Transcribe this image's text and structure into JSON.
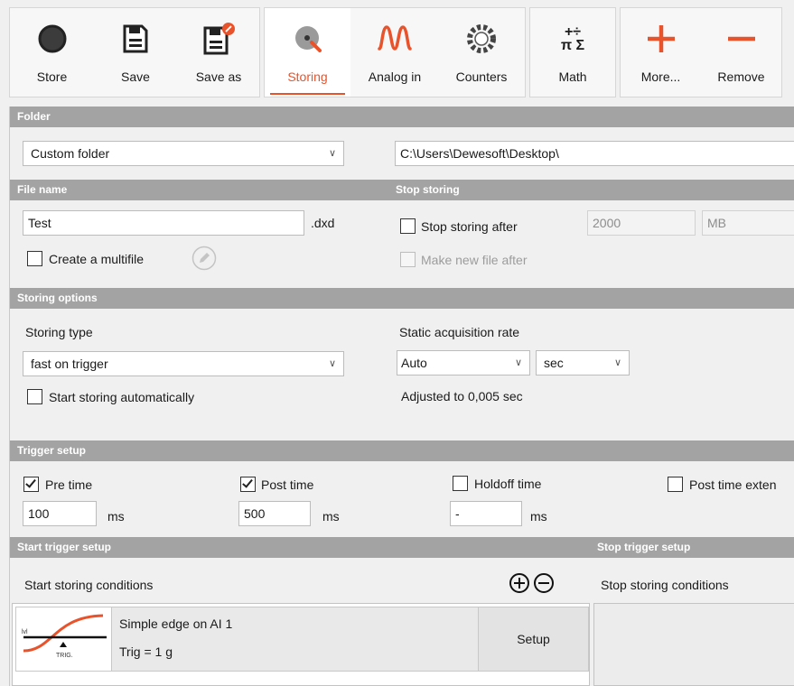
{
  "toolbar": {
    "store": "Store",
    "save": "Save",
    "save_as": "Save as",
    "storing": "Storing",
    "analog_in": "Analog in",
    "counters": "Counters",
    "math": "Math",
    "math_glyph_top": "+÷",
    "math_glyph_bottom": "π Σ",
    "more": "More...",
    "remove": "Remove"
  },
  "colors": {
    "accent": "#e8532b",
    "header": "#a3a3a3",
    "panel": "#f0f0f0"
  },
  "folder": {
    "header": "Folder",
    "type_value": "Custom folder",
    "path_value": "C:\\Users\\Dewesoft\\Desktop\\"
  },
  "file_name": {
    "header": "File name",
    "value": "Test",
    "extension": ".dxd",
    "multifile_label": "Create a multifile",
    "multifile_checked": false
  },
  "stop_storing": {
    "header": "Stop storing",
    "after_label": "Stop storing after",
    "after_checked": false,
    "after_value": "2000",
    "unit_value": "MB",
    "new_file_label": "Make new file after"
  },
  "storing_options": {
    "header": "Storing options",
    "type_label": "Storing type",
    "type_value": "fast on trigger",
    "auto_start_label": "Start storing automatically",
    "rate_label": "Static acquisition rate",
    "rate_value": "Auto",
    "rate_unit": "sec",
    "adjusted_text": "Adjusted to 0,005 sec"
  },
  "trigger_setup": {
    "header": "Trigger setup",
    "pre_time_label": "Pre time",
    "pre_time_checked": true,
    "pre_time_value": "100",
    "pre_time_unit": "ms",
    "post_time_label": "Post time",
    "post_time_checked": true,
    "post_time_value": "500",
    "post_time_unit": "ms",
    "holdoff_label": "Holdoff time",
    "holdoff_checked": false,
    "holdoff_value": "-",
    "holdoff_unit": "ms",
    "post_ext_label": "Post time exten"
  },
  "start_trigger": {
    "header": "Start trigger setup",
    "conditions_label": "Start storing conditions",
    "item_title": "Simple edge on AI 1",
    "item_detail": "Trig = 1 g",
    "thumb_lvl": "lvl",
    "thumb_trig": "TRIG.",
    "setup_label": "Setup"
  },
  "stop_trigger": {
    "header": "Stop trigger setup",
    "conditions_label": "Stop storing conditions"
  }
}
